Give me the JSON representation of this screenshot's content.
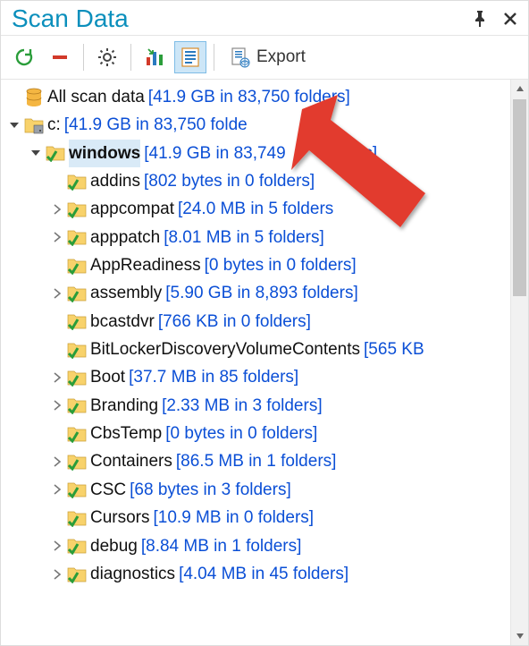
{
  "title": "Scan Data",
  "toolbar": {
    "export_label": "Export"
  },
  "root": {
    "name": "All scan data",
    "stats": "[41.9 GB in 83,750 folders]"
  },
  "drive": {
    "name": "c:",
    "stats": "[41.9 GB in 83,750 folde"
  },
  "selected": {
    "name": "windows",
    "stats": "[41.9 GB in 83,749"
  },
  "selected_after": "lders]",
  "children": [
    {
      "name": "addins",
      "stats": "[802 bytes in 0 folders]",
      "expandable": false
    },
    {
      "name": "appcompat",
      "stats": "[24.0 MB in 5 folders",
      "expandable": true
    },
    {
      "name": "apppatch",
      "stats": "[8.01 MB in 5 folders]",
      "expandable": true
    },
    {
      "name": "AppReadiness",
      "stats": "[0 bytes in 0 folders]",
      "expandable": false
    },
    {
      "name": "assembly",
      "stats": "[5.90 GB in 8,893 folders]",
      "expandable": true
    },
    {
      "name": "bcastdvr",
      "stats": "[766 KB in 0 folders]",
      "expandable": false
    },
    {
      "name": "BitLockerDiscoveryVolumeContents",
      "stats": "[565 KB",
      "expandable": false
    },
    {
      "name": "Boot",
      "stats": "[37.7 MB in 85 folders]",
      "expandable": true
    },
    {
      "name": "Branding",
      "stats": "[2.33 MB in 3 folders]",
      "expandable": true
    },
    {
      "name": "CbsTemp",
      "stats": "[0 bytes in 0 folders]",
      "expandable": false
    },
    {
      "name": "Containers",
      "stats": "[86.5 MB in 1 folders]",
      "expandable": true
    },
    {
      "name": "CSC",
      "stats": "[68 bytes in 3 folders]",
      "expandable": true
    },
    {
      "name": "Cursors",
      "stats": "[10.9 MB in 0 folders]",
      "expandable": false
    },
    {
      "name": "debug",
      "stats": "[8.84 MB in 1 folders]",
      "expandable": true
    },
    {
      "name": "diagnostics",
      "stats": "[4.04 MB in 45 folders]",
      "expandable": true
    }
  ]
}
